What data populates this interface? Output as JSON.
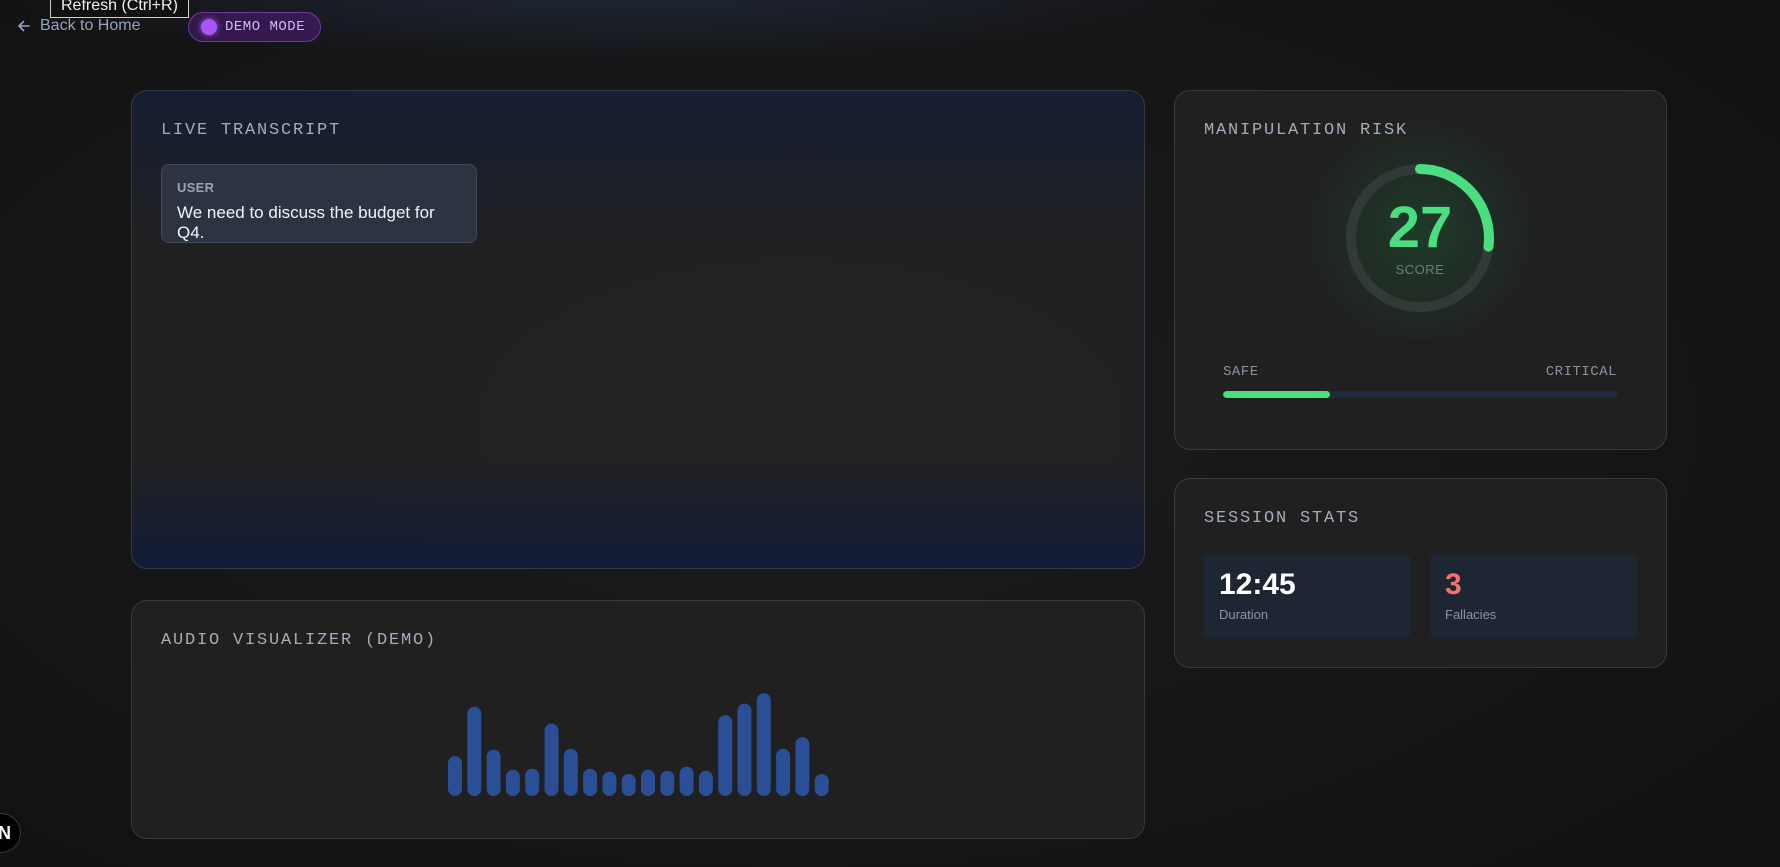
{
  "tooltip": {
    "text": "Refresh (Ctrl+R)"
  },
  "nav": {
    "back_label": "Back to Home"
  },
  "badge": {
    "label": "DEMO MODE",
    "color": "#a855f7"
  },
  "transcript": {
    "title": "LIVE TRANSCRIPT",
    "messages": [
      {
        "role": "USER",
        "text": "We need to discuss the budget for Q4."
      }
    ]
  },
  "visualizer": {
    "title": "AUDIO VISUALIZER (DEMO)",
    "bar_color": "#2a4f96",
    "levels": [
      0.38,
      0.85,
      0.44,
      0.25,
      0.26,
      0.69,
      0.45,
      0.26,
      0.23,
      0.21,
      0.25,
      0.24,
      0.28,
      0.24,
      0.77,
      0.88,
      0.98,
      0.45,
      0.56,
      0.21
    ]
  },
  "risk": {
    "title": "MANIPULATION RISK",
    "score": "27",
    "score_value": 27,
    "score_label": "SCORE",
    "scale_min_label": "SAFE",
    "scale_max_label": "CRITICAL",
    "color": "#4ade80"
  },
  "stats": {
    "title": "SESSION STATS",
    "items": [
      {
        "value": "12:45",
        "label": "Duration",
        "color": "#ffffff"
      },
      {
        "value": "3",
        "label": "Fallacies",
        "color": "#f87171"
      }
    ]
  },
  "dev_indicator": {
    "label": "N"
  }
}
